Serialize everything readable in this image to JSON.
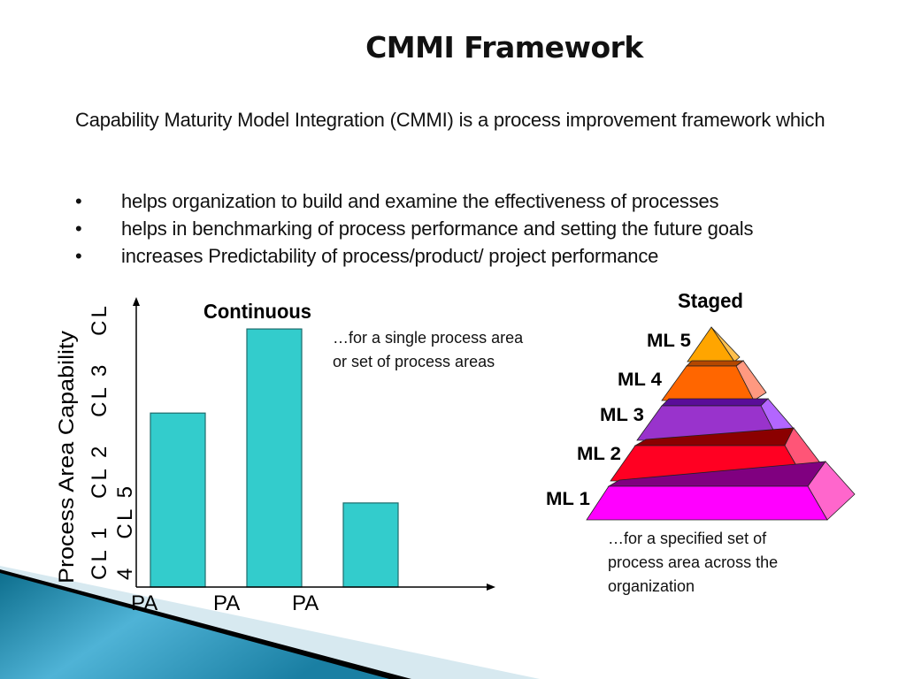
{
  "slide": {
    "title": "CMMI Framework",
    "intro": "Capability Maturity Model Integration (CMMI) is a process improvement framework which",
    "bullets": [
      {
        "marker": "•",
        "text": "helps organization to build and examine the effectiveness of  processes"
      },
      {
        "marker": "•",
        "text": "helps in benchmarking of process performance and setting the future goals"
      },
      {
        "marker": "•",
        "text": "increases Predictability of  process/product/ project performance"
      }
    ]
  },
  "continuous": {
    "title": "Continuous",
    "note_line1": "…for a single process area",
    "note_line2": "or set of process areas",
    "bar_color": "#33CCCC"
  },
  "chart_data": {
    "type": "bar",
    "title": "Continuous",
    "xlabel": "",
    "ylabel": "Process Area Capability",
    "ytick_text_line1": "CL 1   CL 2   CL 3   CL",
    "ytick_text_line2": "4   CL 5",
    "categories": [
      "PA",
      "PA",
      "PA"
    ],
    "values": [
      3.0,
      4.45,
      1.45
    ],
    "ylim": [
      0,
      5
    ],
    "grid": false,
    "legend": "none"
  },
  "staged": {
    "title": "Staged",
    "levels": [
      {
        "label": "ML 5",
        "front": "#FFA500",
        "side": "#FFC04D",
        "top": "#CC8400"
      },
      {
        "label": "ML 4",
        "front": "#FF6600",
        "side": "#FF9980",
        "top": "#B34700"
      },
      {
        "label": "ML 3",
        "front": "#9933CC",
        "side": "#B366FF",
        "top": "#5A0D99"
      },
      {
        "label": "ML 2",
        "front": "#FF0022",
        "side": "#FF5577",
        "top": "#8B0000"
      },
      {
        "label": "ML 1",
        "front": "#FF00FF",
        "side": "#FF66CC",
        "top": "#800080"
      }
    ],
    "note_line1": "…for a specified set of",
    "note_line2": "process area across the",
    "note_line3": "organization"
  }
}
